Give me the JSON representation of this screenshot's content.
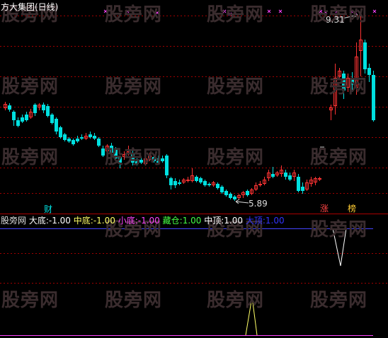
{
  "title": "方大集团(日线)",
  "watermark": "股旁网",
  "high_label": "9.31",
  "low_label": "5.89",
  "markers": {
    "cai": "财",
    "zhang": "涨",
    "bang": "榜"
  },
  "indicator": {
    "name": "股旁网",
    "items": [
      {
        "label": "大底:",
        "value": "-1.00",
        "color": "#ffffff"
      },
      {
        "label": "中底:",
        "value": "-1.00",
        "color": "#ffff66"
      },
      {
        "label": "小底:",
        "value": "-1.00",
        "color": "#ff44ff"
      },
      {
        "label": "藏仓:",
        "value": "1.00",
        "color": "#44ff44"
      },
      {
        "label": "中顶:",
        "value": "1.00",
        "color": "#ffffff"
      },
      {
        "label": "大顶:",
        "value": "1.00",
        "color": "#3333ff"
      }
    ]
  },
  "colors": {
    "up": "#ff3333",
    "down": "#00e0e0",
    "grid": "#a00000",
    "indicator_line": "#4444ff"
  }
}
